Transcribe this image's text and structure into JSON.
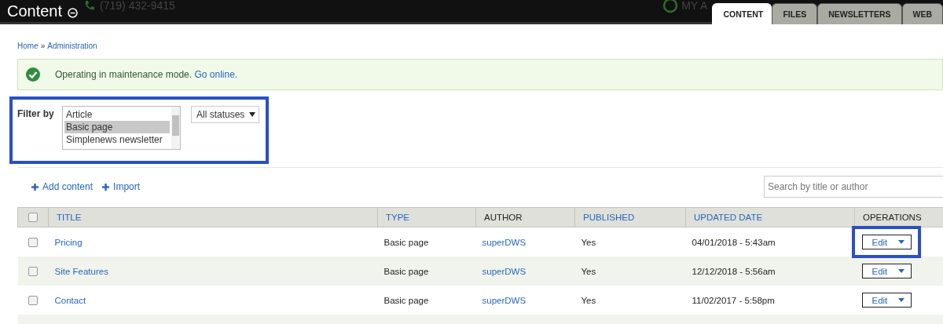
{
  "header": {
    "title": "Content",
    "phone": "(719) 432-9415",
    "account": "MY A"
  },
  "tabs": [
    {
      "label": "CONTENT",
      "selected": true
    },
    {
      "label": "FILES",
      "selected": false
    },
    {
      "label": "NEWSLETTERS",
      "selected": false
    },
    {
      "label": "WEB",
      "selected": false
    }
  ],
  "breadcrumb": {
    "items": [
      "Home",
      "Administration"
    ],
    "separator": "»"
  },
  "message": {
    "text": "Operating in maintenance mode.",
    "link": "Go online."
  },
  "filter": {
    "label": "Filter by",
    "highlighted": true,
    "type_options": [
      {
        "label": "Article",
        "selected": false
      },
      {
        "label": "Basic page",
        "selected": true
      },
      {
        "label": "Simplenews newsletter",
        "selected": false
      }
    ],
    "status": "All statuses"
  },
  "actions": [
    "Add content",
    "Import"
  ],
  "search": {
    "placeholder": "Search by title or author"
  },
  "table": {
    "select_all_checked": false,
    "columns": [
      {
        "label": "TITLE",
        "sortable": true
      },
      {
        "label": "TYPE",
        "sortable": true
      },
      {
        "label": "AUTHOR",
        "sortable": false
      },
      {
        "label": "PUBLISHED",
        "sortable": true
      },
      {
        "label": "UPDATED DATE",
        "sortable": true
      },
      {
        "label": "OPERATIONS",
        "sortable": false
      }
    ],
    "rows": [
      {
        "checked": false,
        "title": "Pricing",
        "type": "Basic page",
        "author": "superDWS",
        "published": "Yes",
        "updated": "04/01/2018 - 5:43am",
        "operation": "Edit",
        "highlighted": true
      },
      {
        "checked": false,
        "title": "Site Features",
        "type": "Basic page",
        "author": "superDWS",
        "published": "Yes",
        "updated": "12/12/2018 - 5:56am",
        "operation": "Edit",
        "highlighted": false
      },
      {
        "checked": false,
        "title": "Contact",
        "type": "Basic page",
        "author": "superDWS",
        "published": "Yes",
        "updated": "11/02/2017 - 5:58pm",
        "operation": "Edit",
        "highlighted": false
      }
    ]
  }
}
